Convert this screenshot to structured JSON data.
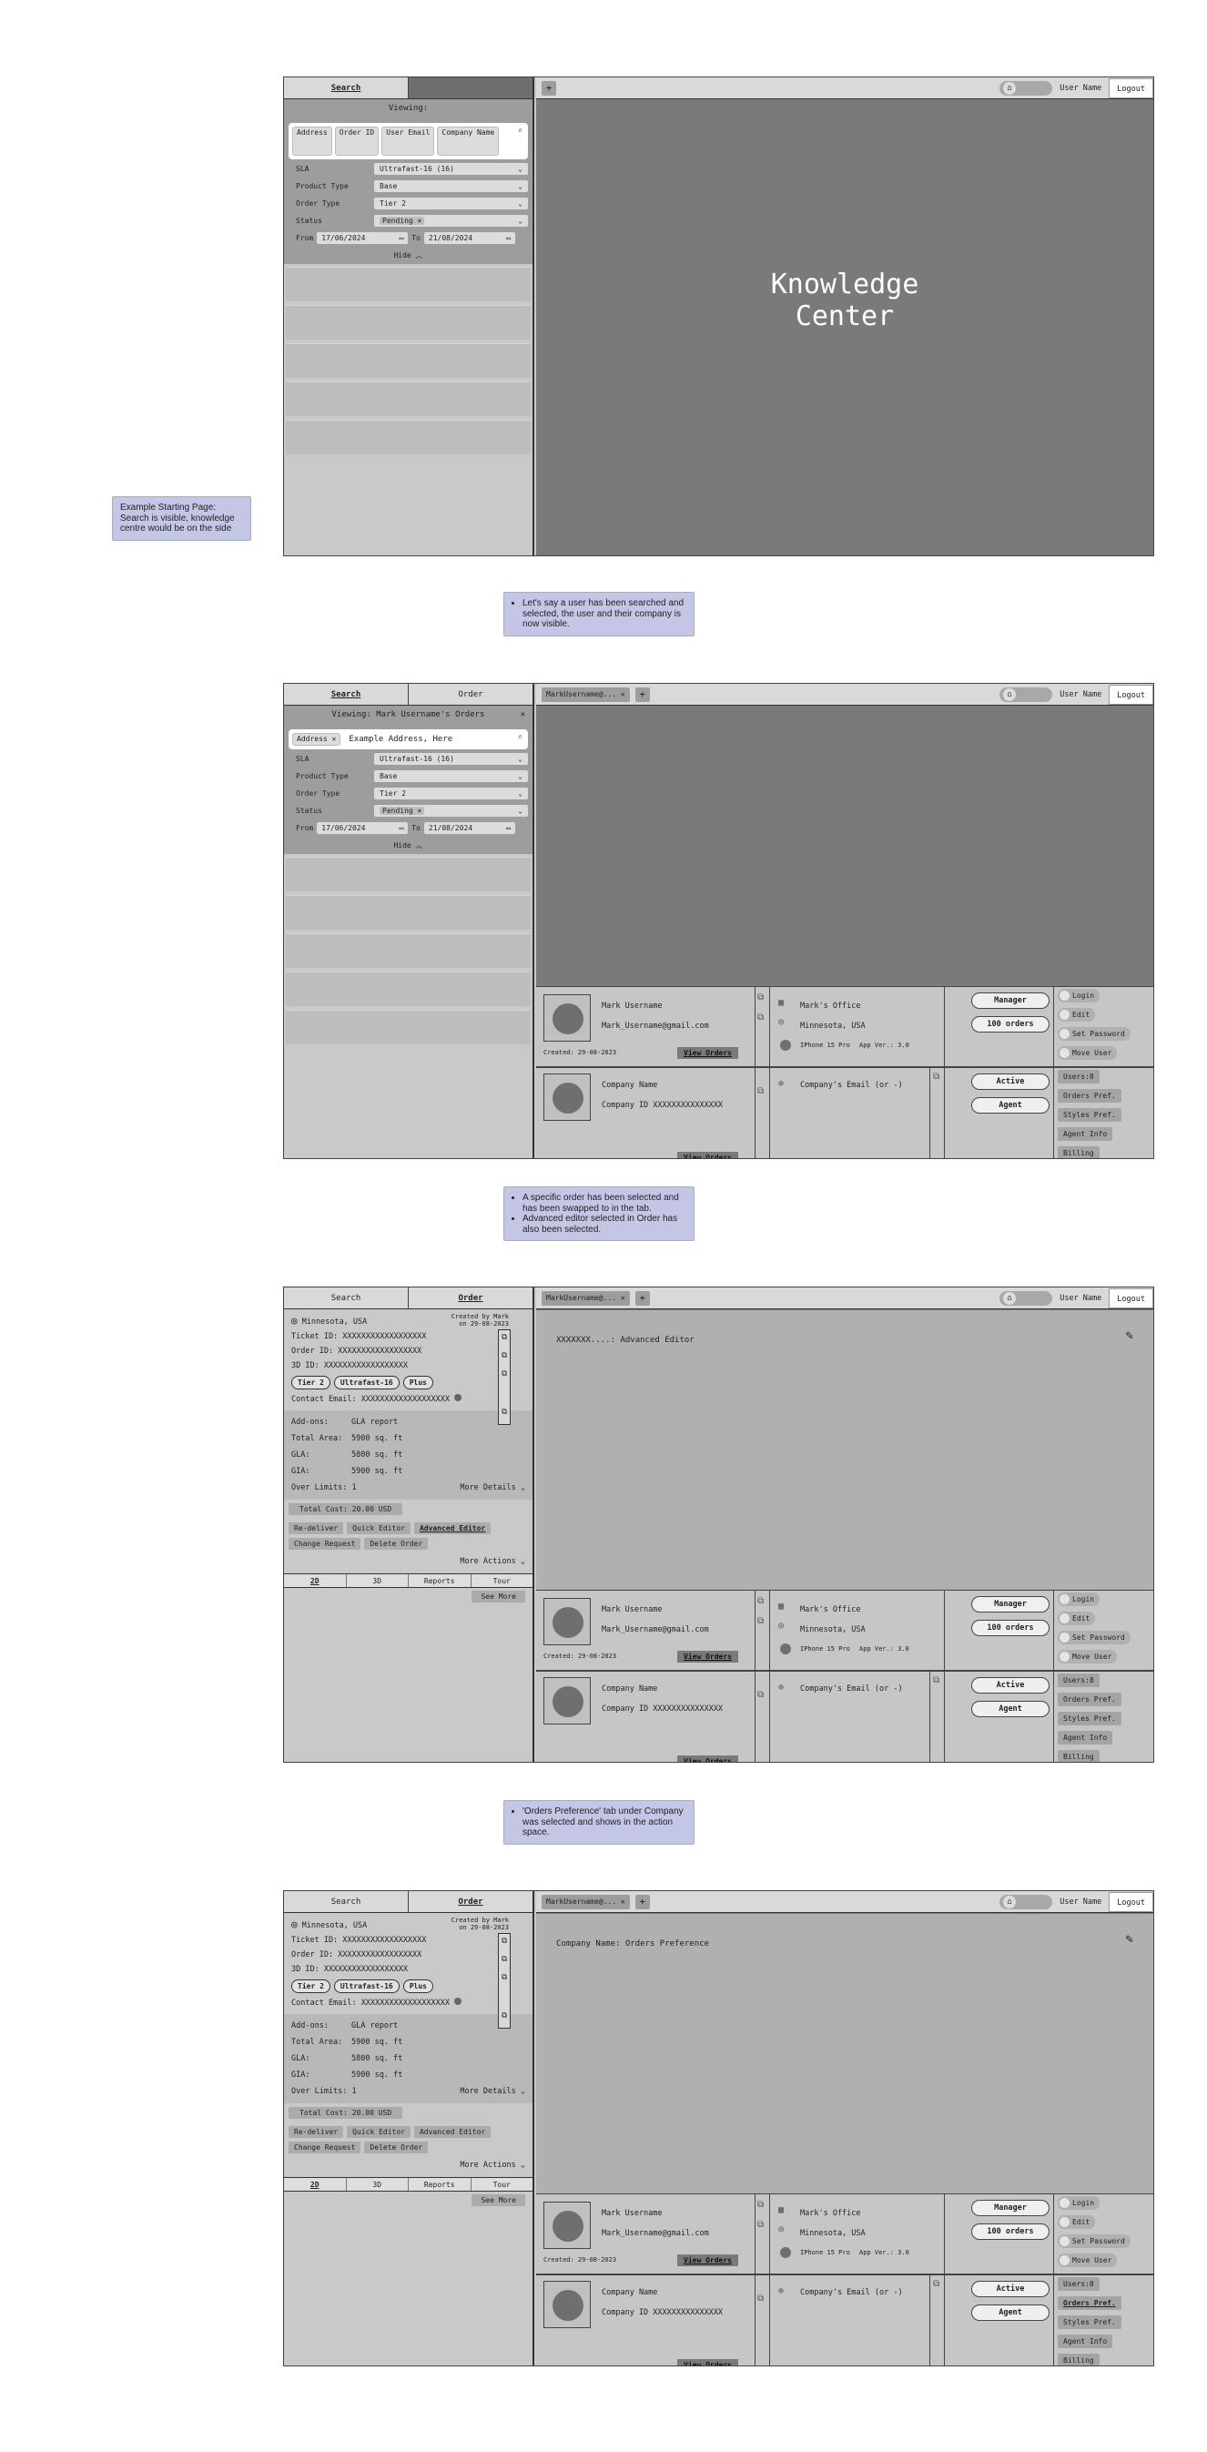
{
  "notes": {
    "n1": "Example Starting Page: Search is visible, knowledge centre would be on the side",
    "n2": "Let's say a user has been searched and selected, the user and their company is now visible.",
    "n3a": "A specific order has been selected and has been swapped to in the tab.",
    "n3b": "Advanced editor selected in Order has also been selected.",
    "n4": "'Orders Preference' tab under Company was selected and shows in the action space."
  },
  "tabs": {
    "search": "Search",
    "order": "Order"
  },
  "topbar": {
    "user_name": "User Name",
    "logout": "Logout",
    "plus": "+",
    "user_tab": "MarkUsername@...",
    "close": "×"
  },
  "viewing": {
    "empty": "Viewing:",
    "mark": "Viewing: Mark Username's Orders"
  },
  "search": {
    "chips_empty": [
      "Address",
      "Order ID",
      "User Email",
      "Company Name"
    ],
    "chip_address": "Address",
    "address_value": "Example Address, Here",
    "sla_label": "SLA",
    "sla_value": "Ultrafast-16 (16)",
    "product_label": "Product Type",
    "product_value": "Base",
    "ordertype_label": "Order Type",
    "ordertype_value": "Tier 2",
    "status_label": "Status",
    "status_value": "Pending",
    "from_label": "From",
    "from_value": "17/06/2024",
    "to_label": "To",
    "to_value": "21/08/2024",
    "hide": "Hide"
  },
  "kc": {
    "line1": "Knowledge",
    "line2": "Center"
  },
  "action": {
    "advanced": "XXXXXXX....: Advanced Editor",
    "prefs": "Company Name: Orders Preference"
  },
  "user": {
    "name": "Mark Username",
    "email": "Mark_Username@gmail.com",
    "created": "Created: 29-08-2023",
    "view_orders": "View Orders",
    "office": "Mark's Office",
    "location": "Minnesota, USA",
    "device": "IPhone 15 Pro",
    "app_ver": "App Ver.: 3.0",
    "manager": "Manager",
    "orders_count": "100 orders"
  },
  "company": {
    "name": "Company Name",
    "id": "Company ID XXXXXXXXXXXXXXX",
    "email": "Company's Email (or -)",
    "active": "Active",
    "agent": "Agent"
  },
  "user_menu": {
    "login": "Login",
    "edit": "Edit",
    "set_password": "Set Password",
    "move_user": "Move User"
  },
  "company_menu": {
    "users": "Users:8",
    "orders_pref": "Orders Pref.",
    "styles_pref": "Styles Pref.",
    "agent_info": "Agent Info",
    "billing": "Billing"
  },
  "order": {
    "location": "Minnesota, USA",
    "created": "Created by Mark",
    "created_on": "on 29-08-2023",
    "ticket": "Ticket ID: XXXXXXXXXXXXXXXXXX",
    "order_id": "Order ID:  XXXXXXXXXXXXXXXXXX",
    "id3d": "3D ID:     XXXXXXXXXXXXXXXXXX",
    "tags": [
      "Tier 2",
      "Ultrafast-16",
      "Plus"
    ],
    "contact": "Contact Email: XXXXXXXXXXXXXXXXXXX",
    "addons_k": "Add-ons:",
    "addons_v": "GLA report",
    "area_k": "Total Area:",
    "area_v": "5900 sq. ft",
    "gla_k": "GLA:",
    "gla_v": "5800 sq. ft",
    "gia_k": "GIA:",
    "gia_v": "5900 sq. ft",
    "over_k": "Over Limits:",
    "over_v": "1",
    "more_details": "More Details",
    "total": "Total Cost: 20.00 USD",
    "btns": [
      "Re-deliver",
      "Quick Editor",
      "Advanced Editor",
      "Change Request",
      "Delete Order"
    ],
    "more_actions": "More Actions",
    "btabs": [
      "2D",
      "3D",
      "Reports",
      "Tour"
    ],
    "see_more": "See More"
  }
}
